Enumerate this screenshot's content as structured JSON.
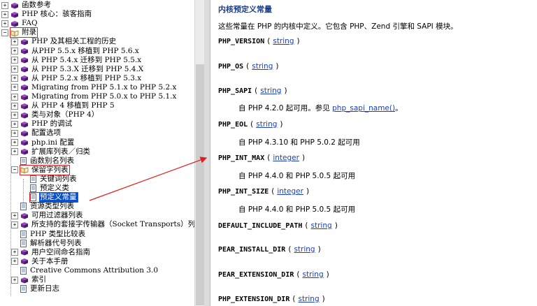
{
  "tree": {
    "items": [
      {
        "label": "函数参考",
        "expander": "+",
        "icon": "book"
      },
      {
        "label": "PHP 核心：骇客指南",
        "expander": "+",
        "icon": "book"
      },
      {
        "label": "FAQ",
        "expander": "+",
        "icon": "book"
      },
      {
        "label": "附录",
        "expander": "−",
        "icon": "book-open"
      },
      {
        "label": "PHP 及其相关工程的历史",
        "expander": "+",
        "icon": "book"
      },
      {
        "label": "从PHP 5.5.x 移植到 PHP 5.6.x",
        "expander": "+",
        "icon": "book"
      },
      {
        "label": "从 PHP 5.4.x 迁移到 PHP 5.5.x",
        "expander": "+",
        "icon": "book"
      },
      {
        "label": "从 PHP 5.3.X 迁移到 PHP 5.4.X",
        "expander": "+",
        "icon": "book"
      },
      {
        "label": "从 PHP 5.2.x 移植到 PHP 5.3.x",
        "expander": "+",
        "icon": "book"
      },
      {
        "label": "Migrating from PHP 5.1.x to PHP 5.2.x",
        "expander": "+",
        "icon": "book"
      },
      {
        "label": "Migrating from PHP 5.0.x to PHP 5.1.x",
        "expander": "+",
        "icon": "book"
      },
      {
        "label": "从 PHP 4 移植到 PHP 5",
        "expander": "+",
        "icon": "book"
      },
      {
        "label": "类与对象（PHP 4）",
        "expander": "+",
        "icon": "book"
      },
      {
        "label": "PHP 的调试",
        "expander": "+",
        "icon": "book"
      },
      {
        "label": "配置选项",
        "expander": "+",
        "icon": "book"
      },
      {
        "label": "php.ini 配置",
        "expander": "+",
        "icon": "book"
      },
      {
        "label": "扩展库列表／归类",
        "expander": "+",
        "icon": "book"
      },
      {
        "label": "函数别名列表",
        "expander": "",
        "icon": "page"
      },
      {
        "label": "保留字列表",
        "expander": "−",
        "icon": "book-open"
      },
      {
        "label": "关键词列表",
        "expander": "",
        "icon": "page"
      },
      {
        "label": "预定义类",
        "expander": "",
        "icon": "page"
      },
      {
        "label": "预定义常量",
        "expander": "",
        "icon": "page"
      },
      {
        "label": "资源类型列表",
        "expander": "",
        "icon": "page"
      },
      {
        "label": "可用过滤器列表",
        "expander": "+",
        "icon": "book"
      },
      {
        "label": "所支持的套接字传输器（Socket Transports）列",
        "expander": "+",
        "icon": "book"
      },
      {
        "label": "PHP 类型比较表",
        "expander": "",
        "icon": "page"
      },
      {
        "label": "解析器代号列表",
        "expander": "",
        "icon": "page"
      },
      {
        "label": "用户空间命名指南",
        "expander": "+",
        "icon": "book"
      },
      {
        "label": "关于本手册",
        "expander": "+",
        "icon": "book"
      },
      {
        "label": "Creative Commons Attribution 3.0",
        "expander": "",
        "icon": "page"
      },
      {
        "label": "索引",
        "expander": "+",
        "icon": "book"
      },
      {
        "label": "更新日志",
        "expander": "",
        "icon": "page"
      }
    ]
  },
  "content": {
    "title": "内核预定义常量",
    "intro": "这些常量在 PHP 的内核中定义。它包含 PHP、Zend 引擎和 SAPI 模块。",
    "constants": [
      {
        "name": "PHP_VERSION",
        "type": "string",
        "desc": "",
        "link": "",
        "desc_suffix": ""
      },
      {
        "name": "PHP_OS",
        "type": "string",
        "desc": "",
        "link": "",
        "desc_suffix": ""
      },
      {
        "name": "PHP_SAPI",
        "type": "string",
        "desc": "自 PHP 4.2.0 起可用。参见 ",
        "link": "php_sapi_name()",
        "desc_suffix": "。"
      },
      {
        "name": "PHP_EOL",
        "type": "string",
        "desc": "自 PHP 4.3.10 和 PHP 5.0.2 起可用",
        "link": "",
        "desc_suffix": ""
      },
      {
        "name": "PHP_INT_MAX",
        "type": "integer",
        "desc": "自 PHP 4.4.0 和 PHP 5.0.5 起可用",
        "link": "",
        "desc_suffix": ""
      },
      {
        "name": "PHP_INT_SIZE",
        "type": "integer",
        "desc": "自 PHP 4.4.0 和 PHP 5.0.5 起可用",
        "link": "",
        "desc_suffix": ""
      },
      {
        "name": "DEFAULT_INCLUDE_PATH",
        "type": "string",
        "desc": "",
        "link": "",
        "desc_suffix": ""
      },
      {
        "name": "PEAR_INSTALL_DIR",
        "type": "string",
        "desc": "",
        "link": "",
        "desc_suffix": ""
      },
      {
        "name": "PEAR_EXTENSION_DIR",
        "type": "string",
        "desc": "",
        "link": "",
        "desc_suffix": ""
      },
      {
        "name": "PHP_EXTENSION_DIR",
        "type": "string",
        "desc": "",
        "link": "",
        "desc_suffix": ""
      }
    ],
    "paren_open": "(",
    "paren_close": ")"
  },
  "colors": {
    "title": "#1a3e8c",
    "link": "#1a3ec0",
    "selection": "#0a50c8",
    "highlight_box": "#e02020",
    "book_icon": "#6b2a8a"
  }
}
